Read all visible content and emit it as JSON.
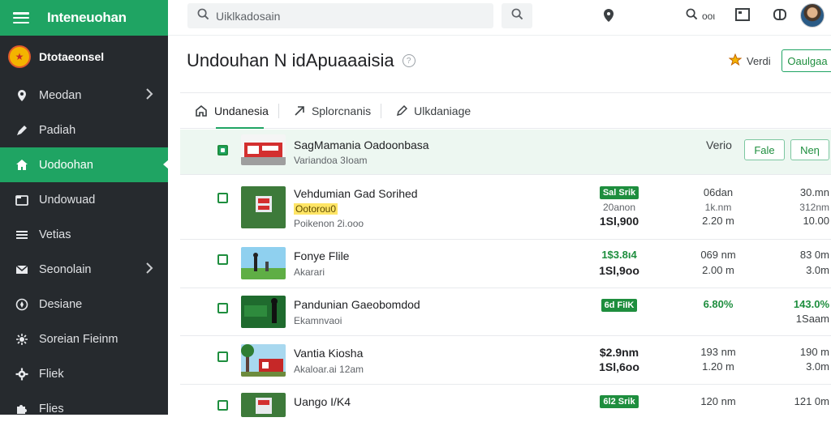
{
  "app": {
    "title": "Inteneuohan"
  },
  "account": {
    "name": "Dtotaeonsel"
  },
  "sidebar": {
    "items": [
      {
        "label": "Meodan",
        "icon": "pin-icon",
        "chevron": true
      },
      {
        "label": "Padiah",
        "icon": "edit-icon",
        "chevron": false
      },
      {
        "label": "Uodoohan",
        "icon": "home-icon",
        "chevron": false,
        "active": true
      },
      {
        "label": "Undowuad",
        "icon": "folder-icon",
        "chevron": false
      },
      {
        "label": "Vetias",
        "icon": "list-icon",
        "chevron": false
      },
      {
        "label": "Seonolain",
        "icon": "mail-icon",
        "chevron": true
      },
      {
        "label": "Desiane",
        "icon": "compass-icon",
        "chevron": false
      },
      {
        "label": "Soreian Fieinm",
        "icon": "settings-icon",
        "chevron": false
      },
      {
        "label": "Fliek",
        "icon": "gear-icon",
        "chevron": false
      },
      {
        "label": "Flies",
        "icon": "puzzle-icon",
        "chevron": false
      }
    ]
  },
  "search": {
    "value": "Uiklkadosain"
  },
  "topbar": {
    "oot_label": "ooι"
  },
  "page": {
    "title": "Undouhan N idApuaaaisia",
    "help": "?",
    "verdi_label": "Verdi",
    "action_label": "Oaulgaa"
  },
  "tabs": [
    {
      "label": "Undanesia",
      "icon": "home-outline-icon"
    },
    {
      "label": "Splorcnanis",
      "icon": "arrow-icon"
    },
    {
      "label": "Ulkdaniage",
      "icon": "pencil-icon"
    }
  ],
  "header_row": {
    "title": "SagMamania Oadoonbasa",
    "subtitle": "Variandoa 3Ioam",
    "col_label": "Verio",
    "btn1": "Fale",
    "btn2": "Neη"
  },
  "rows": [
    {
      "title": "Vehdumian Gad Sorihed",
      "tag": "Ootorou0",
      "subtitle": "Poikenon 2i.ooo",
      "a1": "Sal Srik",
      "a2": "20anon",
      "a3": "1Sl,900",
      "b1": "06dan",
      "b2": "1k.nm",
      "b3": "2.20 m",
      "c1": "30.mn",
      "c2": "312nm",
      "c3": "10.00"
    },
    {
      "title": "Fonye Flile",
      "subtitle": "Akarari",
      "a1": "1$3.8ι4",
      "a3": "1Sl,9oo",
      "b1": "069 nm",
      "b3": "2.00 m",
      "c1": "83 0m",
      "c3": "3.0m"
    },
    {
      "title": "Pandunian Gaeobomdod",
      "subtitle": "Ekamnvaoi",
      "a1": "6d FiIK",
      "b1": "6.80%",
      "c1": "143.0%",
      "c3": "1Saam"
    },
    {
      "title": "Vantia Kiosha",
      "subtitle": "Akaloar.ai 12am",
      "a1": "$2.9nm",
      "a3": "1Sl,6oo",
      "b1": "193 nm",
      "b3": "1.20 m",
      "c1": "190 m",
      "c3": "3.0m"
    },
    {
      "title": "Uango I/K4",
      "a1": "6l2 Srik",
      "b1": "120 nm",
      "c1": "121 0m"
    }
  ]
}
